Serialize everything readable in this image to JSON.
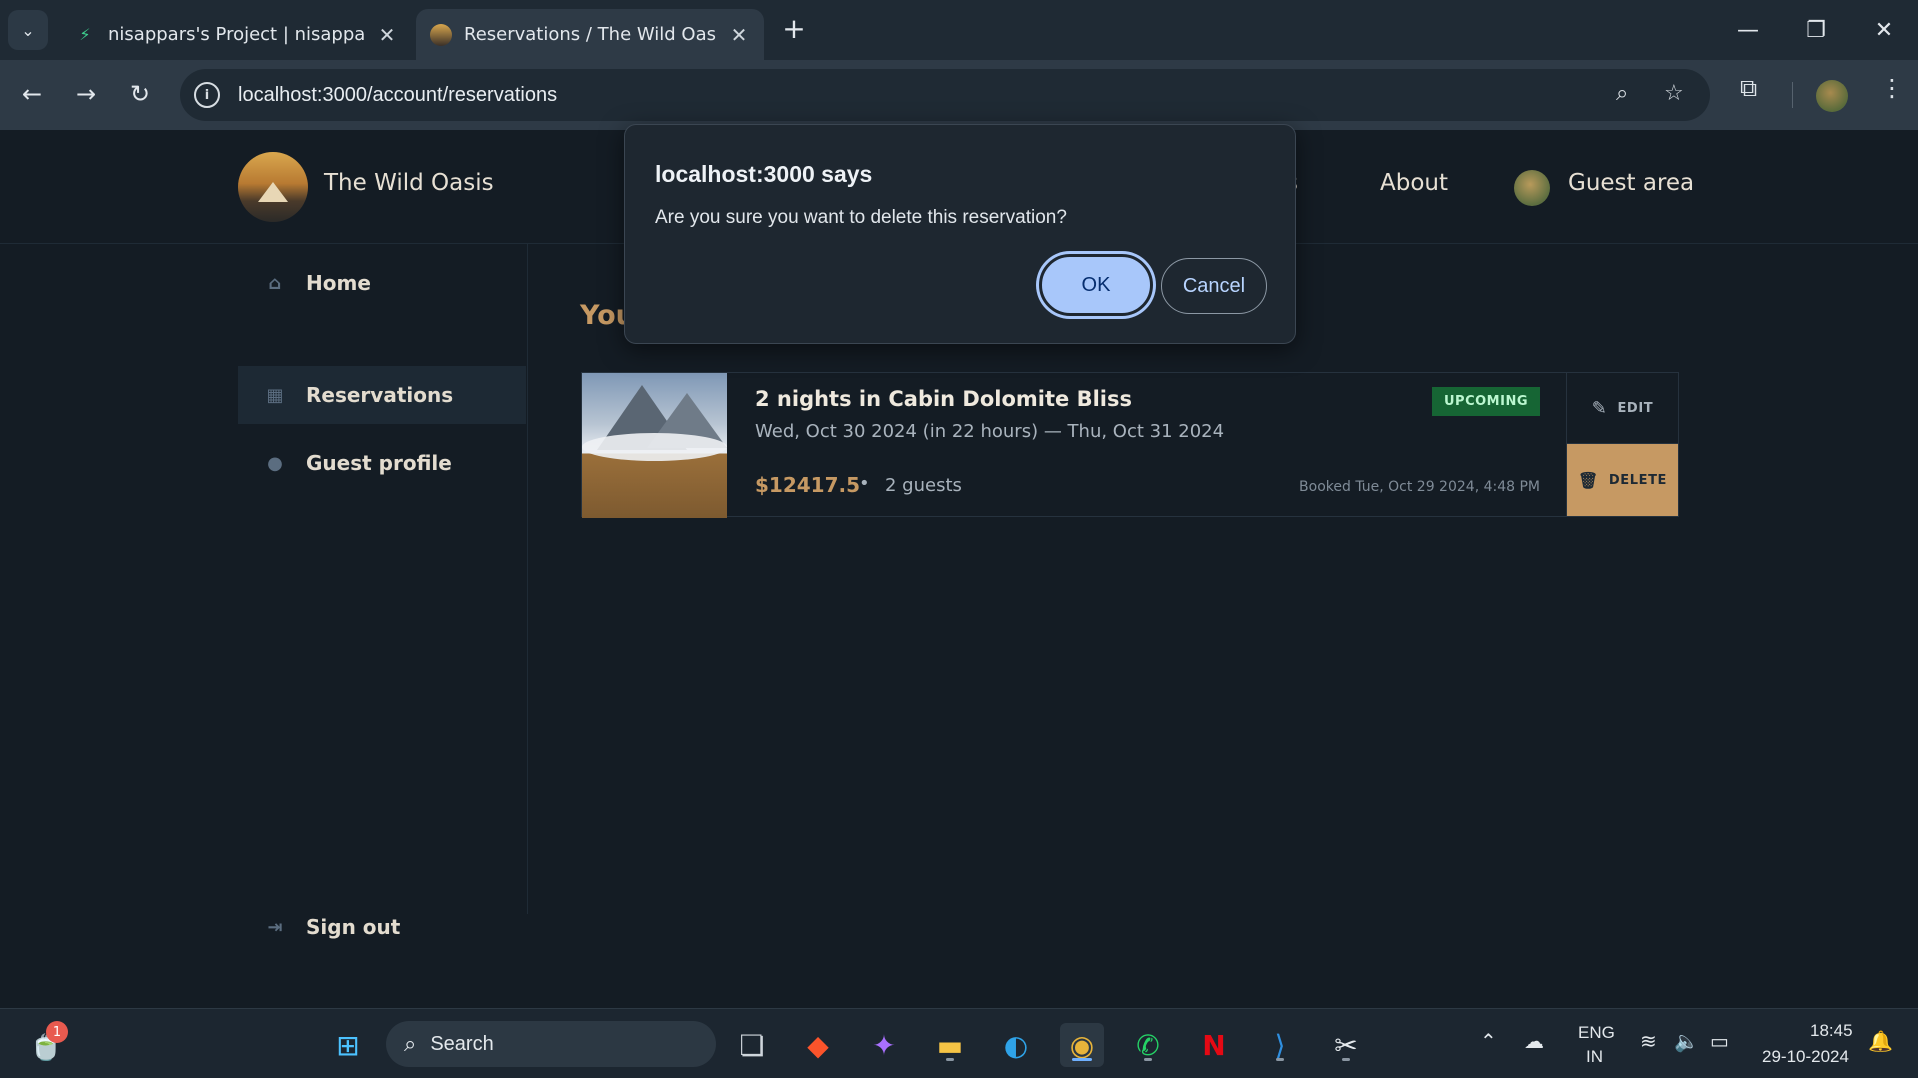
{
  "browser": {
    "tabs": [
      {
        "title": "nisappars's Project | nisappars's",
        "active": false
      },
      {
        "title": "Reservations / The Wild Oasis",
        "active": true
      }
    ],
    "url": "localhost:3000/account/reservations"
  },
  "site": {
    "brand": "The Wild Oasis",
    "nav_partial": "s",
    "nav_about": "About",
    "nav_guest": "Guest area"
  },
  "sidebar": {
    "items": [
      {
        "label": "Home",
        "icon": "home-icon"
      },
      {
        "label": "Reservations",
        "icon": "calendar-icon"
      },
      {
        "label": "Guest profile",
        "icon": "user-icon"
      }
    ],
    "signout": "Sign out"
  },
  "main": {
    "heading_partial": "You"
  },
  "reservation": {
    "title": "2 nights in Cabin Dolomite Bliss",
    "dates": "Wed, Oct 30 2024 (in 22 hours) — Thu, Oct 31 2024",
    "price": "$12417.5",
    "dot": "•",
    "guests": "2 guests",
    "status": "UPCOMING",
    "booked": "Booked Tue, Oct 29 2024, 4:48 PM",
    "edit_label": "EDIT",
    "delete_label": "DELETE"
  },
  "dialog": {
    "title": "localhost:3000 says",
    "message": "Are you sure you want to delete this reservation?",
    "ok": "OK",
    "cancel": "Cancel"
  },
  "taskbar": {
    "search": "Search",
    "notification_count": "1",
    "lang_top": "ENG",
    "lang_bottom": "IN",
    "time": "18:45",
    "date": "29-10-2024"
  },
  "colors": {
    "accent": "#c69963",
    "page_bg": "#141c24",
    "badge_bg": "#166534",
    "dialog_ok": "#a8c7fa"
  }
}
